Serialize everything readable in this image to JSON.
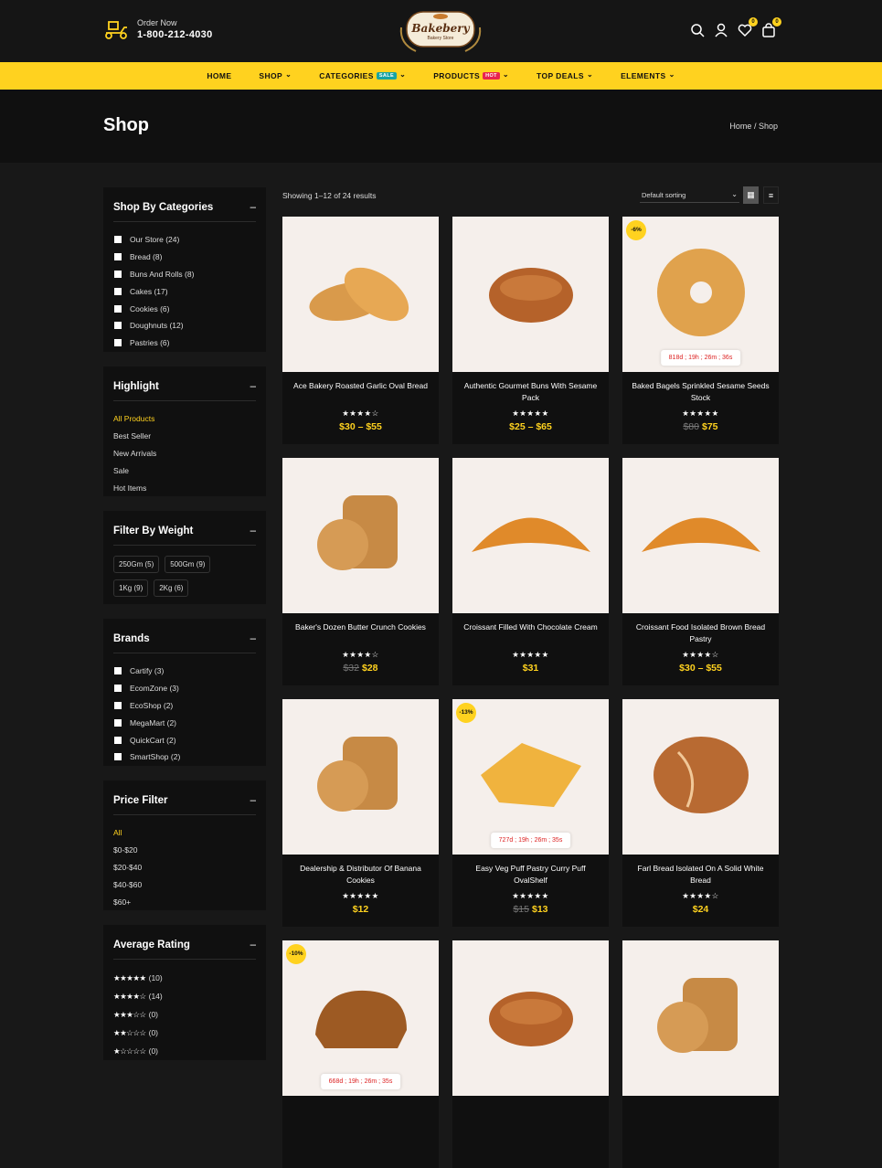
{
  "header": {
    "order_label": "Order Now",
    "phone": "1-800-212-4030",
    "logo_title": "Bakebery",
    "logo_sub": "Bakery Store",
    "wishlist_count": "0",
    "cart_count": "0"
  },
  "nav": [
    {
      "label": "HOME",
      "chev": ""
    },
    {
      "label": "SHOP",
      "chev": "⌄"
    },
    {
      "label": "CATEGORIES",
      "chev": "⌄",
      "tag": "SALE",
      "tag_color": "#16a3a3"
    },
    {
      "label": "PRODUCTS",
      "chev": "⌄",
      "tag": "HOT",
      "tag_color": "#e8234f"
    },
    {
      "label": "TOP DEALS",
      "chev": "⌄"
    },
    {
      "label": "ELEMENTS",
      "chev": "⌄"
    }
  ],
  "hero": {
    "title": "Shop",
    "breadcrumb_home": "Home",
    "breadcrumb_sep": "/",
    "breadcrumb_current": "Shop"
  },
  "sidebar": {
    "categories": {
      "title": "Shop By Categories",
      "items": [
        "Our Store (24)",
        "Bread (8)",
        "Buns And Rolls (8)",
        "Cakes (17)",
        "Cookies (6)",
        "Doughnuts (12)",
        "Pastries (6)"
      ]
    },
    "highlight": {
      "title": "Highlight",
      "items": [
        "All Products",
        "Best Seller",
        "New Arrivals",
        "Sale",
        "Hot Items"
      ]
    },
    "weight": {
      "title": "Filter By Weight",
      "items": [
        "250Gm (5)",
        "500Gm (9)",
        "1Kg (9)",
        "2Kg (6)"
      ]
    },
    "brands": {
      "title": "Brands",
      "items": [
        "Cartify (3)",
        "EcomZone (3)",
        "EcoShop (2)",
        "MegaMart (2)",
        "QuickCart (2)",
        "SmartShop (2)"
      ]
    },
    "price": {
      "title": "Price Filter",
      "items": [
        "All",
        "$0-$20",
        "$20-$40",
        "$40-$60",
        "$60+"
      ]
    },
    "rating": {
      "title": "Average Rating",
      "items": [
        {
          "stars": 5,
          "count": "(10)"
        },
        {
          "stars": 4,
          "count": "(14)"
        },
        {
          "stars": 3,
          "count": "(0)"
        },
        {
          "stars": 2,
          "count": "(0)"
        },
        {
          "stars": 1,
          "count": "(0)"
        }
      ]
    },
    "collapse": "–",
    "active_color": "#ffd21f"
  },
  "toolbar": {
    "results": "Showing 1–12 of 24 results",
    "sort": "Default sorting"
  },
  "products": [
    {
      "name": "Ace Bakery Roasted Garlic Oval Bread",
      "stars": 4,
      "old": "",
      "price": "$30 – $55",
      "disc": "",
      "timer": "",
      "img": "bread-icon"
    },
    {
      "name": "Authentic Gourmet Buns With Sesame Pack",
      "stars": 5,
      "old": "",
      "price": "$25 – $65",
      "disc": "",
      "timer": "",
      "img": "bun-icon"
    },
    {
      "name": "Baked Bagels Sprinkled Sesame Seeds Stock",
      "stars": 5,
      "old": "$80",
      "price": "$75",
      "disc": "-6%",
      "timer": "818d ; 19h ; 26m ; 36s",
      "img": "bagel-icon"
    },
    {
      "name": "Baker's Dozen Butter Crunch Cookies",
      "stars": 4,
      "old": "$32",
      "price": "$28",
      "disc": "",
      "timer": "",
      "img": "cookie-stack-icon"
    },
    {
      "name": "Croissant Filled With Chocolate Cream",
      "stars": 5,
      "old": "",
      "price": "$31",
      "disc": "",
      "timer": "",
      "img": "croissant-icon"
    },
    {
      "name": "Croissant Food Isolated Brown Bread Pastry",
      "stars": 4,
      "old": "",
      "price": "$30 – $55",
      "disc": "",
      "timer": "",
      "img": "croissant-icon"
    },
    {
      "name": "Dealership & Distributor Of Banana Cookies",
      "stars": 5,
      "old": "",
      "price": "$12",
      "disc": "",
      "timer": "",
      "img": "cookie-stack-icon"
    },
    {
      "name": "Easy Veg Puff Pastry Curry Puff OvalShelf",
      "stars": 5,
      "old": "$15",
      "price": "$13",
      "disc": "-13%",
      "timer": "727d ; 19h ; 26m ; 35s",
      "img": "puff-icon"
    },
    {
      "name": "Farl Bread Isolated On A Solid White Bread",
      "stars": 4,
      "old": "",
      "price": "$24",
      "disc": "",
      "timer": "",
      "img": "round-loaf-icon"
    },
    {
      "name": "",
      "stars": 0,
      "old": "",
      "price": "",
      "disc": "-10%",
      "timer": "668d ; 19h ; 26m ; 35s",
      "img": "loaf-icon"
    },
    {
      "name": "",
      "stars": 0,
      "old": "",
      "price": "",
      "disc": "",
      "timer": "",
      "img": "bun-icon"
    },
    {
      "name": "",
      "stars": 0,
      "old": "",
      "price": "",
      "disc": "",
      "timer": "",
      "img": "cookie-stack-icon"
    }
  ]
}
